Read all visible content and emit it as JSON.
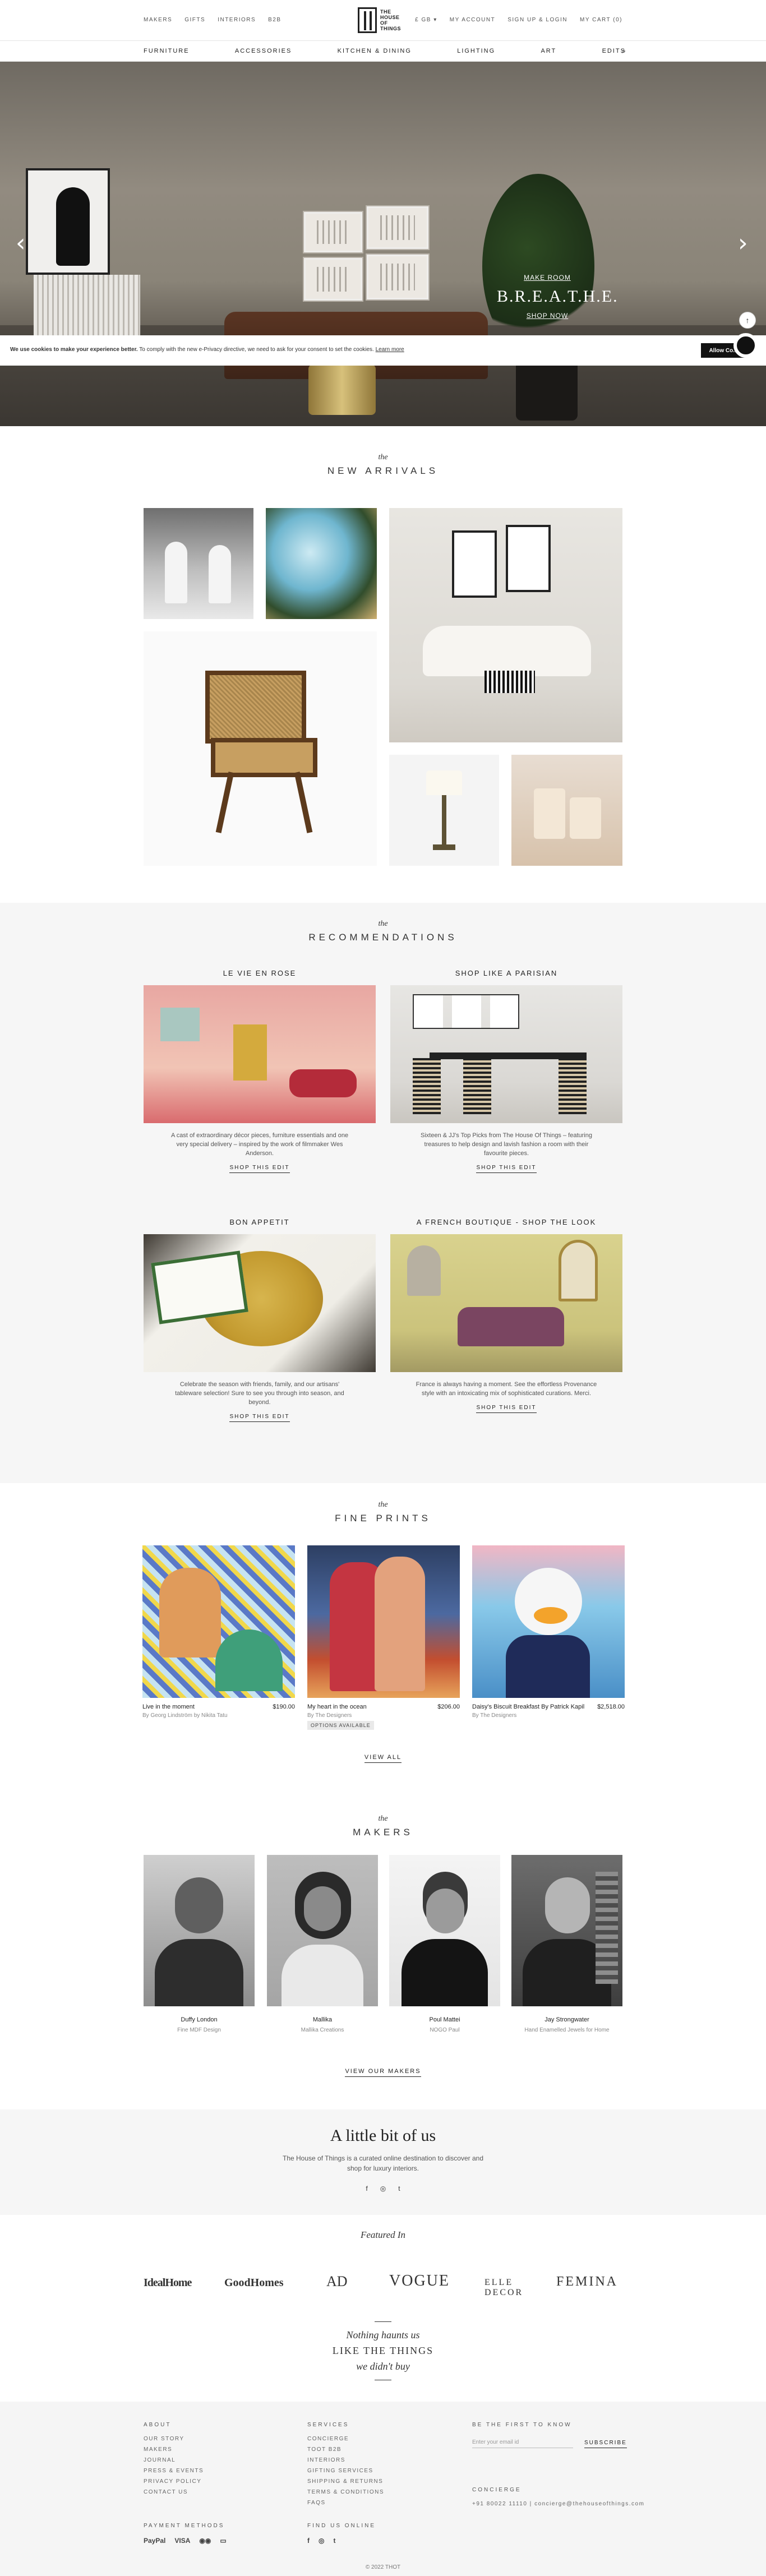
{
  "header": {
    "left_links": [
      "MAKERS",
      "GIFTS",
      "INTERIORS",
      "B2B"
    ],
    "logo_text": [
      "THE",
      "HOUSE",
      "OF",
      "THINGS"
    ],
    "right_links": [
      "£ GB ▾",
      "MY ACCOUNT",
      "SIGN UP & LOGIN",
      "MY CART (0)"
    ],
    "nav": [
      "FURNITURE",
      "ACCESSORIES",
      "KITCHEN & DINING",
      "LIGHTING",
      "ART",
      "EDITS"
    ],
    "search_icon": "search-icon"
  },
  "hero": {
    "eyebrow": "MAKE ROOM",
    "title": "B.R.E.A.T.H.E.",
    "link": "SHOP NOW",
    "prev_icon": "chevron-left-icon",
    "next_icon": "chevron-right-icon"
  },
  "cookie": {
    "bold": "We use cookies to make your experience better.",
    "text": " To comply with the new e-Privacy directive, we need to ask for your consent to set the cookies. ",
    "link": "Learn more",
    "button": "Allow Co..."
  },
  "new_arrivals": {
    "the": "the",
    "title": "NEW ARRIVALS"
  },
  "recommendations": {
    "the": "the",
    "title": "RECOMMENDATIONS",
    "items": [
      {
        "heading": "LE VIE EN ROSE",
        "desc": "A cast of extraordinary décor pieces, furniture essentials and one very special delivery – inspired by the work of filmmaker Wes Anderson.",
        "button": "SHOP THIS EDIT"
      },
      {
        "heading": "SHOP LIKE A PARISIAN",
        "desc": "Sixteen & JJ's Top Picks from The House Of Things – featuring treasures to help design and lavish fashion a room with their favourite pieces.",
        "button": "SHOP THIS EDIT"
      },
      {
        "heading": "BON APPETIT",
        "desc": "Celebrate the season with friends, family, and our artisans' tableware selection! Sure to see you through into season, and beyond.",
        "button": "SHOP THIS EDIT"
      },
      {
        "heading": "A FRENCH BOUTIQUE - SHOP THE LOOK",
        "desc": "France is always having a moment. See the effortless Provenance style with an intoxicating mix of sophisticated curations. Merci.",
        "button": "SHOP THIS EDIT"
      }
    ]
  },
  "fine_prints": {
    "the": "the",
    "title": "FINE PRINTS",
    "items": [
      {
        "name": "Live in the moment",
        "price": "$190.00",
        "by": "By Georg Lindström by Nikita Tatu",
        "badge": ""
      },
      {
        "name": "My heart in the ocean",
        "price": "$206.00",
        "by": "By The Designers",
        "badge": "OPTIONS AVAILABLE"
      },
      {
        "name": "Daisy's Biscuit Breakfast By Patrick Kapil",
        "price": "$2,518.00",
        "by": "By The Designers",
        "badge": ""
      }
    ],
    "view_all": "VIEW ALL"
  },
  "makers": {
    "the": "the",
    "title": "MAKERS",
    "items": [
      {
        "name": "Duffy London",
        "sub": "Fine MDF Design"
      },
      {
        "name": "Mallika",
        "sub": "Mallika Creations"
      },
      {
        "name": "Poul Mattei",
        "sub": "NOGO Paul"
      },
      {
        "name": "Jay Strongwater",
        "sub": "Hand Enamelled Jewels for Home"
      }
    ],
    "view_all": "VIEW OUR MAKERS"
  },
  "about": {
    "title": "A little bit of us",
    "text": "The House of Things is a curated online destination to discover and shop for luxury interiors.",
    "social": [
      "f",
      "◎",
      "t"
    ]
  },
  "featured": {
    "title": "Featured In",
    "press": [
      "IdealHome",
      "GoodHomes",
      "AD",
      "VOGUE",
      "ELLE DECOR",
      "FEMINA"
    ]
  },
  "quote": {
    "line1": "Nothing haunts us",
    "line2": "LIKE THE THINGS",
    "line3": "we didn't buy"
  },
  "footer": {
    "about": {
      "heading": "ABOUT",
      "items": [
        "OUR STORY",
        "MAKERS",
        "JOURNAL",
        "PRESS & EVENTS",
        "PRIVACY POLICY",
        "CONTACT US"
      ]
    },
    "services": {
      "heading": "SERVICES",
      "items": [
        "CONCIERGE",
        "TOOT B2B",
        "INTERIORS",
        "GIFTING SERVICES",
        "SHIPPING & RETURNS",
        "TERMS & CONDITIONS",
        "FAQS"
      ]
    },
    "newsletter": {
      "heading": "BE THE FIRST TO KNOW",
      "placeholder": "Enter your email id",
      "button": "SUBSCRIBE"
    },
    "concierge": {
      "heading": "CONCIERGE",
      "contact": "+91 80022 11110 | concierge@thehouseofthings.com"
    },
    "payment": {
      "heading": "PAYMENT METHODS",
      "methods": [
        "PayPal",
        "VISA",
        "◉◉",
        "▭"
      ]
    },
    "follow": {
      "heading": "FIND US ONLINE",
      "icons": [
        "f",
        "◎",
        "t"
      ]
    },
    "copyright": "© 2022 THOT"
  }
}
